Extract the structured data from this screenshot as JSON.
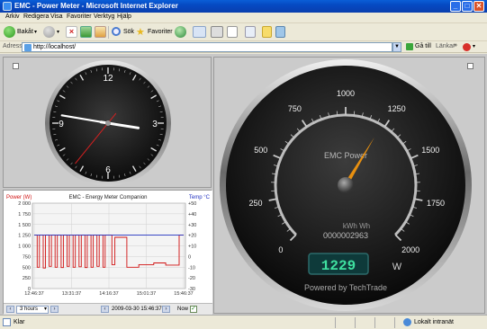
{
  "window": {
    "title": "EMC - Power Meter - Microsoft Internet Explorer",
    "minimize": "_",
    "maximize": "□",
    "close": "✕"
  },
  "menu": [
    "Arkiv",
    "Redigera",
    "Visa",
    "Favoriter",
    "Verktyg",
    "Hjälp"
  ],
  "toolbar": {
    "back": "Bakåt",
    "search": "Sök",
    "favorites": "Favoriter"
  },
  "address": {
    "label": "Adress",
    "url": "http://localhost/",
    "go": "Gå till",
    "links": "Länkar"
  },
  "clock": {
    "numerals": [
      "12",
      "3",
      "6",
      "9"
    ],
    "hour": 15.3,
    "minute": 46.6,
    "second": 36.5,
    "accent": "#d62020"
  },
  "chart": {
    "title": "EMC - Energy Meter Companion",
    "left_label": "Power (W)",
    "right_label": "Temp °C",
    "left_ticks": [
      "2 000",
      "1 750",
      "1 500",
      "1 250",
      "1 000",
      "750",
      "500",
      "250",
      "0"
    ],
    "right_ticks": [
      "+50",
      "+40",
      "+30",
      "+20",
      "+10",
      "0",
      "-10",
      "-20",
      "-30"
    ],
    "x_ticks": [
      "12:46:37",
      "13:31:37",
      "14:16:37",
      "15:01:37",
      "15:46:37"
    ],
    "power_color": "#d01010",
    "temp_color": "#2030c0",
    "range": "3 hours",
    "date": "2009-03-30 15:46:37",
    "now_label": "Now"
  },
  "chart_data": {
    "type": "line",
    "x": [
      "12:46:37",
      "13:31:37",
      "14:16:37",
      "15:01:37",
      "15:46:37"
    ],
    "series": [
      {
        "name": "Power (W)",
        "axis": "left",
        "ylim": [
          0,
          2000
        ],
        "points": [
          [
            0.0,
            1250
          ],
          [
            0.02,
            1250
          ],
          [
            0.02,
            500
          ],
          [
            0.035,
            500
          ],
          [
            0.035,
            1250
          ],
          [
            0.06,
            1250
          ],
          [
            0.06,
            480
          ],
          [
            0.075,
            480
          ],
          [
            0.075,
            1250
          ],
          [
            0.1,
            1250
          ],
          [
            0.1,
            520
          ],
          [
            0.115,
            520
          ],
          [
            0.115,
            1250
          ],
          [
            0.14,
            1250
          ],
          [
            0.14,
            500
          ],
          [
            0.155,
            500
          ],
          [
            0.155,
            1250
          ],
          [
            0.18,
            1250
          ],
          [
            0.18,
            490
          ],
          [
            0.195,
            490
          ],
          [
            0.195,
            1250
          ],
          [
            0.22,
            1250
          ],
          [
            0.22,
            520
          ],
          [
            0.235,
            520
          ],
          [
            0.235,
            1250
          ],
          [
            0.26,
            1250
          ],
          [
            0.26,
            500
          ],
          [
            0.275,
            500
          ],
          [
            0.275,
            1250
          ],
          [
            0.3,
            1250
          ],
          [
            0.3,
            510
          ],
          [
            0.315,
            510
          ],
          [
            0.315,
            1250
          ],
          [
            0.34,
            1250
          ],
          [
            0.34,
            490
          ],
          [
            0.355,
            490
          ],
          [
            0.355,
            1250
          ],
          [
            0.38,
            1250
          ],
          [
            0.38,
            500
          ],
          [
            0.395,
            500
          ],
          [
            0.395,
            1250
          ],
          [
            0.42,
            1250
          ],
          [
            0.42,
            520
          ],
          [
            0.435,
            520
          ],
          [
            0.435,
            1250
          ],
          [
            0.46,
            1250
          ],
          [
            0.46,
            500
          ],
          [
            0.475,
            500
          ],
          [
            0.475,
            1250
          ],
          [
            0.52,
            1250
          ],
          [
            0.52,
            560
          ],
          [
            0.54,
            560
          ],
          [
            0.54,
            1200
          ],
          [
            0.62,
            1200
          ],
          [
            0.62,
            500
          ],
          [
            0.7,
            500
          ],
          [
            0.7,
            560
          ],
          [
            0.8,
            560
          ],
          [
            0.8,
            600
          ],
          [
            0.88,
            600
          ],
          [
            0.88,
            550
          ],
          [
            0.97,
            550
          ],
          [
            0.97,
            1250
          ],
          [
            1.0,
            1250
          ]
        ]
      },
      {
        "name": "Temp °C",
        "axis": "right",
        "ylim": [
          -30,
          50
        ],
        "points": [
          [
            0.0,
            20
          ],
          [
            1.0,
            20
          ]
        ]
      }
    ]
  },
  "gauge": {
    "ticks": [
      "0",
      "250",
      "500",
      "750",
      "1000",
      "1250",
      "1500",
      "1750",
      "2000"
    ],
    "max": 2000,
    "value": 1229,
    "label": "EMC Power",
    "kwh_label": "kWh  Wh",
    "counter": "0000002963",
    "unit": "W",
    "footer": "Powered by TechTrade",
    "needle_color": "#e89010",
    "display_color": "#3fe0a0"
  },
  "status": {
    "text": "Klar",
    "zone": "Lokalt intranät"
  }
}
